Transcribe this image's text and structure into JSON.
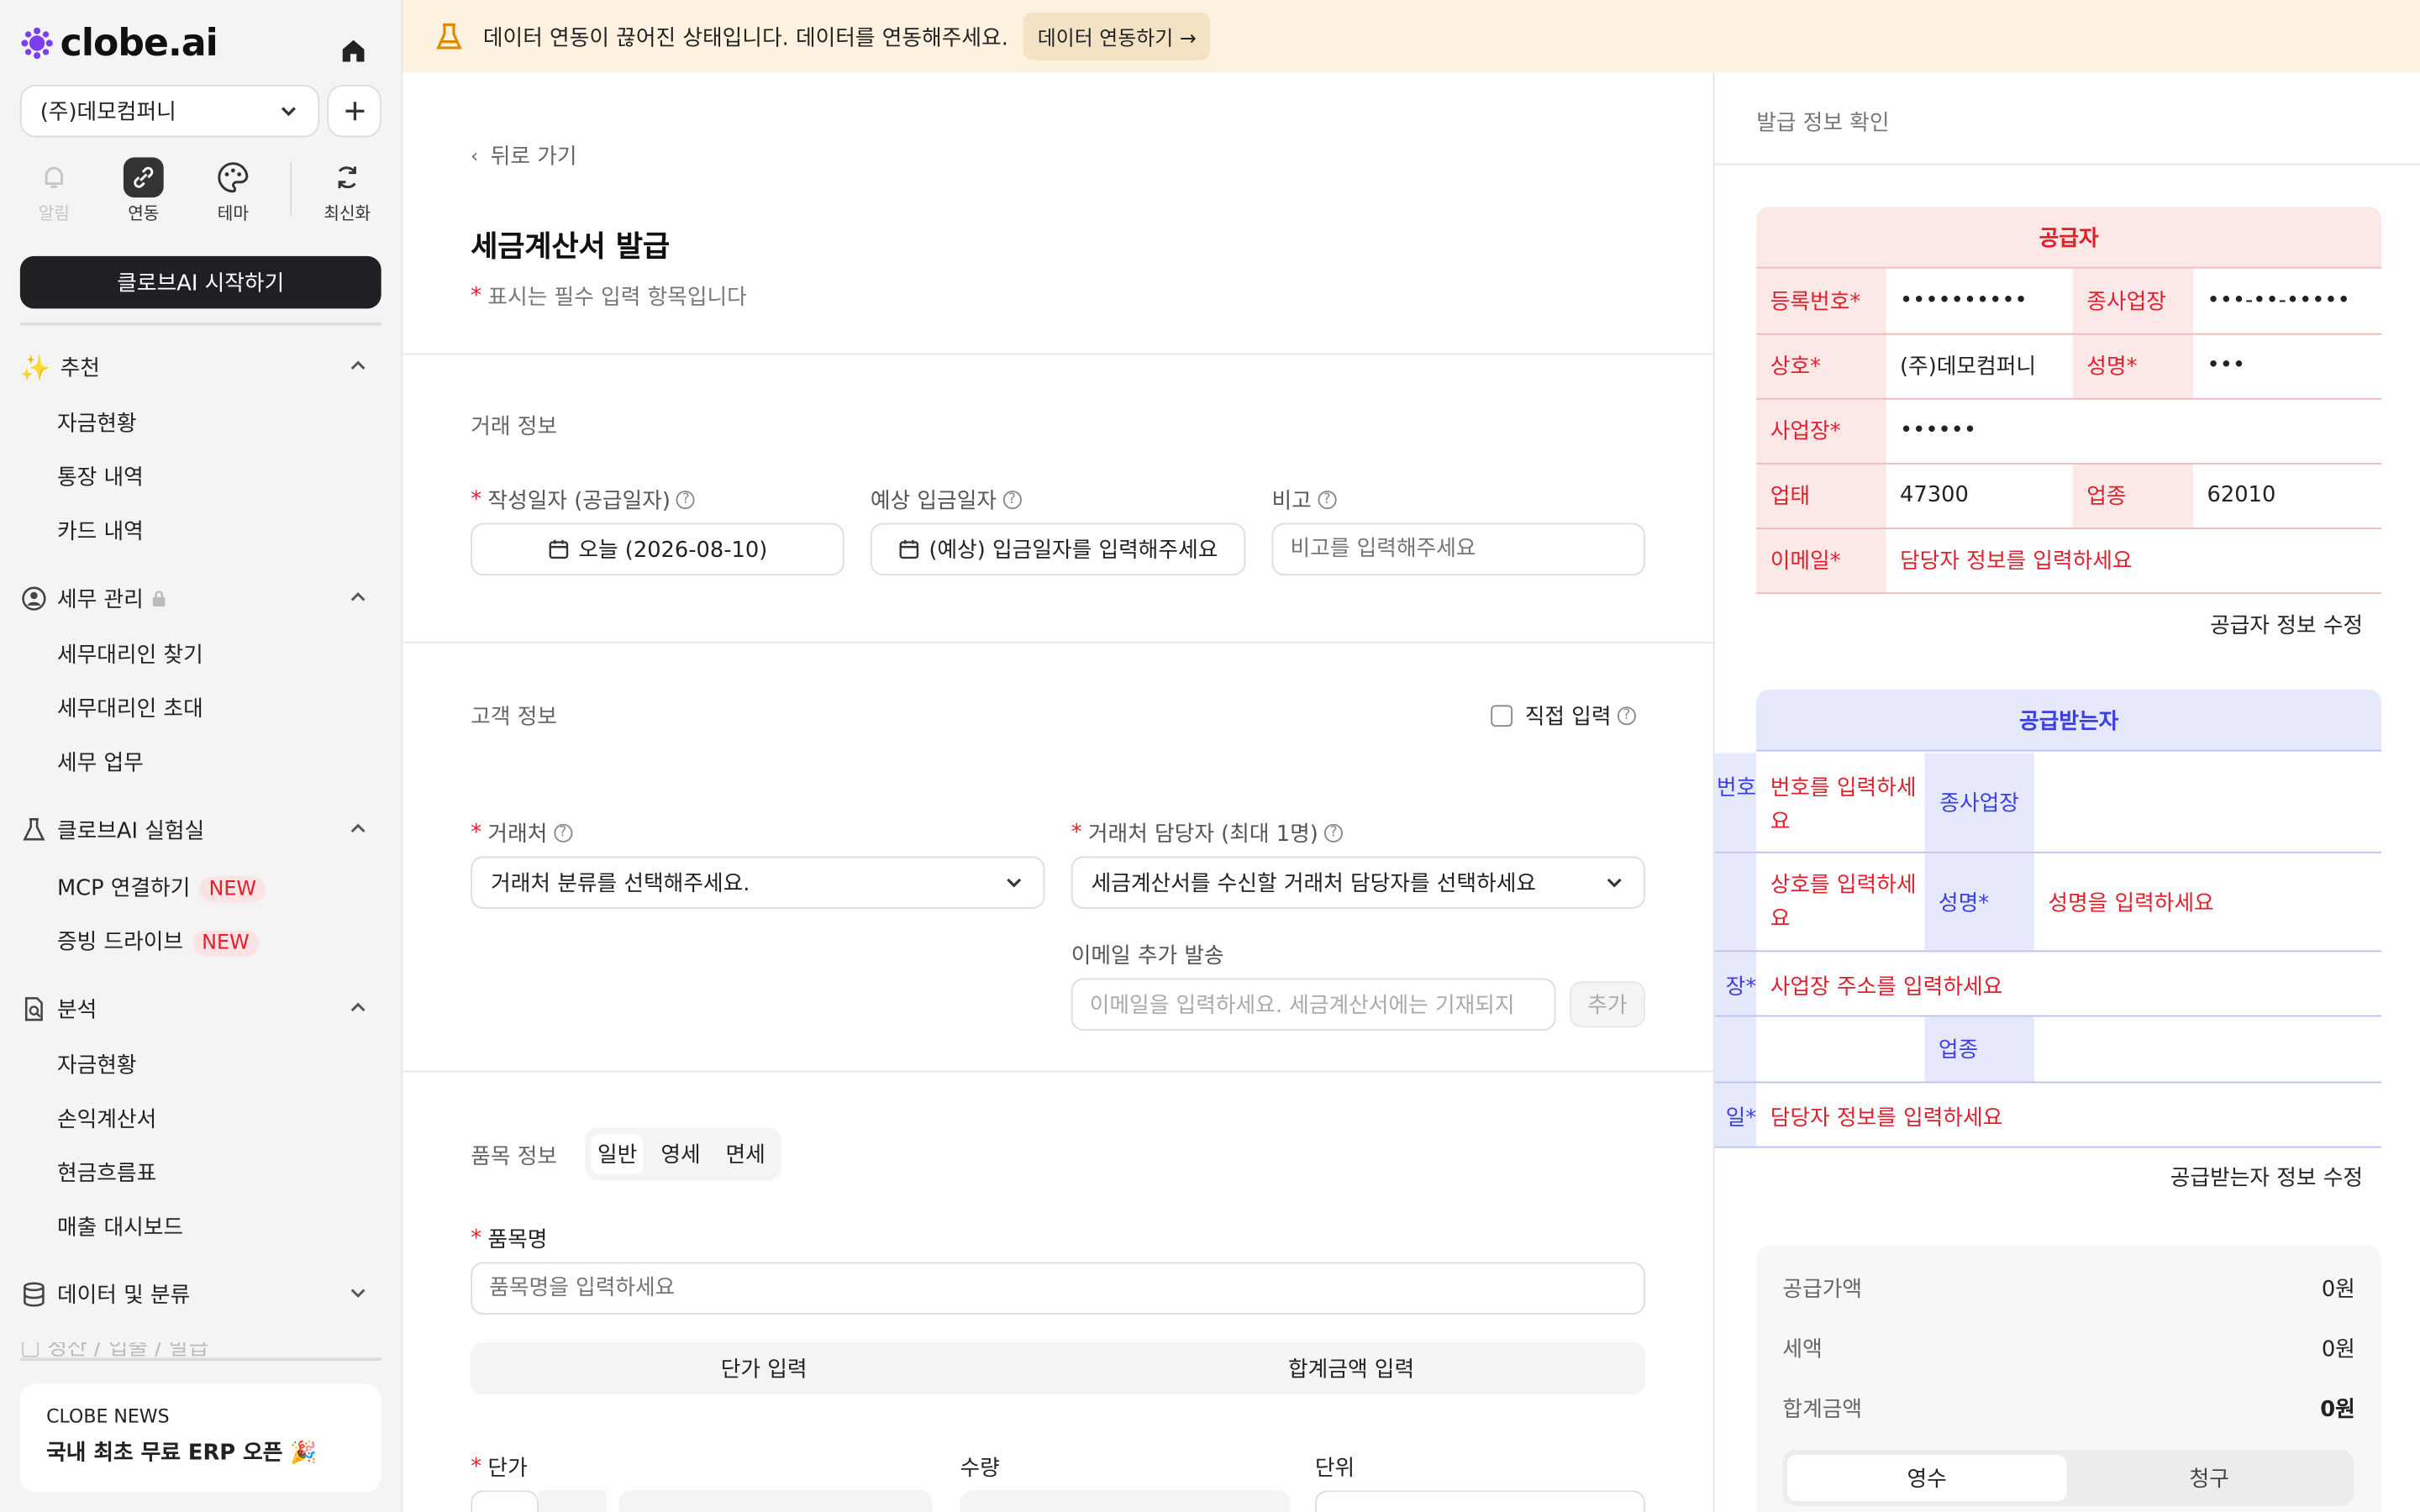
{
  "brand": {
    "name": "clobe.ai"
  },
  "sidebar": {
    "company": "(주)데모컴퍼니",
    "quick": [
      {
        "label": "알림",
        "icon": "bell-icon"
      },
      {
        "label": "연동",
        "icon": "link-icon"
      },
      {
        "label": "테마",
        "icon": "palette-icon"
      },
      {
        "label": "최신화",
        "icon": "refresh-icon"
      }
    ],
    "start_button": "클로브AI 시작하기",
    "sections": [
      {
        "title": "추천",
        "icon": "sparkle-icon",
        "items": [
          "자금현황",
          "통장 내역",
          "카드 내역"
        ]
      },
      {
        "title": "세무 관리",
        "icon": "person-icon",
        "items": [
          "세무대리인 찾기",
          "세무대리인 초대",
          "세무 업무"
        ]
      },
      {
        "title": "클로브AI 실험실",
        "icon": "flask-icon",
        "items": [
          "MCP 연결하기",
          "증빙 드라이브"
        ]
      },
      {
        "title": "분석",
        "icon": "search-doc-icon",
        "items": [
          "자금현황",
          "손익계산서",
          "현금흐름표",
          "매출 대시보드"
        ]
      },
      {
        "title": "데이터 및 분류",
        "icon": "database-icon",
        "items": []
      }
    ],
    "cut_section": "정산 / 입출 / 발급",
    "new_badge": "NEW",
    "news": {
      "label": "CLOBE NEWS",
      "title": "국내 최초 무료 ERP 오픈 🎉"
    }
  },
  "banner": {
    "text": "데이터 연동이 끊어진 상태입니다. 데이터를 연동해주세요.",
    "button": "데이터 연동하기 →"
  },
  "form": {
    "back": "뒤로 가기",
    "title": "세금계산서 발급",
    "required_note": "표시는 필수 입력 항목입니다",
    "deal_section": "거래 정보",
    "write_date_label": "작성일자 (공급일자)",
    "write_date_value": "오늘 (2026-08-10)",
    "expected_label": "예상 입금일자",
    "expected_value": "(예상) 입금일자를 입력해주세요",
    "note_label": "비고",
    "note_placeholder": "비고를 입력해주세요",
    "customer_section": "고객 정보",
    "direct_input": "직접 입력",
    "partner_label": "거래처",
    "partner_placeholder": "거래처 분류를 선택해주세요.",
    "manager_label": "거래처 담당자 (최대 1명)",
    "manager_placeholder": "세금계산서를 수신할 거래처 담당자를 선택하세요",
    "email_extra_label": "이메일 추가 발송",
    "email_placeholder": "이메일을 입력하세요. 세금계산서에는 기재되지",
    "add_button": "추가",
    "item_section": "품목 정보",
    "item_tabs": [
      "일반",
      "영세",
      "면세"
    ],
    "item_name_label": "품목명",
    "item_name_placeholder": "품목명을 입력하세요",
    "price_mode": [
      "단가 입력",
      "합계금액 입력"
    ],
    "unit_price_label": "단가",
    "qty_label": "수량",
    "unit_label": "단위"
  },
  "preview": {
    "title": "발급 정보 확인",
    "supplier_header": "공급자",
    "supplier_rows": [
      {
        "k1": "등록번호*",
        "v1": "••••••••••",
        "k2": "종사업장",
        "v2": "•••-••-•••••"
      },
      {
        "k1": "상호*",
        "v1": "(주)데모컴퍼니",
        "k2": "성명*",
        "v2": "•••"
      },
      {
        "k1": "사업장*",
        "v1": "••••••"
      },
      {
        "k1": "업태",
        "v1": "47300",
        "k2": "업종",
        "v2": "62010"
      },
      {
        "k1": "이메일*",
        "v1": "담당자 정보를 입력하세요"
      }
    ],
    "supplier_edit": "공급자 정보 수정",
    "receiver_header": "공급받는자",
    "receiver_rows": [
      {
        "k1": "번호",
        "v1": "번호를 입력하세요",
        "k2": "종사업장",
        "v2": ""
      },
      {
        "k1": "",
        "v1": "상호를 입력하세요",
        "k2": "성명*",
        "v2": "성명을 입력하세요"
      },
      {
        "k1": "장*",
        "v1": "사업장 주소를 입력하세요"
      },
      {
        "k1": "",
        "v1": "",
        "k2": "업종",
        "v2": ""
      },
      {
        "k1": "일*",
        "v1": "담당자 정보를 입력하세요"
      }
    ],
    "receiver_edit": "공급받는자 정보 수정",
    "summary": [
      {
        "label": "공급가액",
        "value": "0원"
      },
      {
        "label": "세액",
        "value": "0원"
      },
      {
        "label": "합계금액",
        "value": "0원"
      }
    ],
    "receipt_tabs": [
      "영수",
      "청구"
    ]
  },
  "colors": {
    "accent_red": "#e0212d",
    "accent_blue": "#3b3fe6",
    "supplier_bg": "#fde8e8",
    "receiver_bg": "#e6e9fb",
    "banner_bg": "#fdf2df"
  }
}
